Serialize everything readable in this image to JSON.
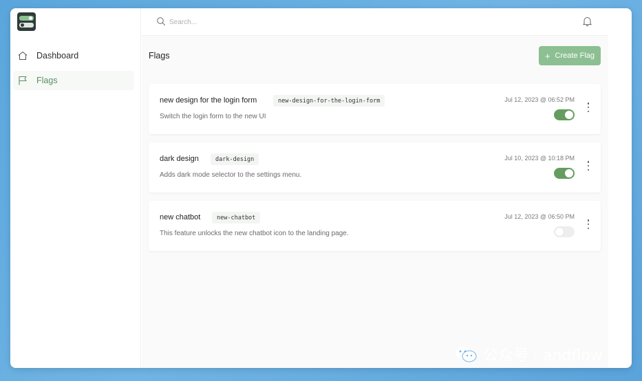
{
  "sidebar": {
    "items": [
      {
        "label": "Dashboard",
        "icon": "home-icon",
        "active": false
      },
      {
        "label": "Flags",
        "icon": "flag-icon",
        "active": true
      }
    ]
  },
  "topbar": {
    "search_placeholder": "Search...",
    "notifications_icon": "bell-icon"
  },
  "main": {
    "title": "Flags",
    "create_button_label": "Create Flag",
    "flags": [
      {
        "name": "new design for the login form",
        "key": "new-design-for-the-login-form",
        "description": "Switch the login form to the new UI",
        "date": "Jul 12, 2023 @ 06:52 PM",
        "enabled": true
      },
      {
        "name": "dark design",
        "key": "dark-design",
        "description": "Adds dark mode selector to the settings menu.",
        "date": "Jul 10, 2023 @ 10:18 PM",
        "enabled": true
      },
      {
        "name": "new chatbot",
        "key": "new-chatbot",
        "description": "This feature unlocks the new chatbot icon to the landing page.",
        "date": "Jul 12, 2023 @ 06:50 PM",
        "enabled": false
      }
    ]
  },
  "watermark": {
    "text": "公众号 · andflow"
  },
  "colors": {
    "accent": "#649d5f",
    "button": "#8cbf91",
    "background": "#5aa6dc"
  }
}
